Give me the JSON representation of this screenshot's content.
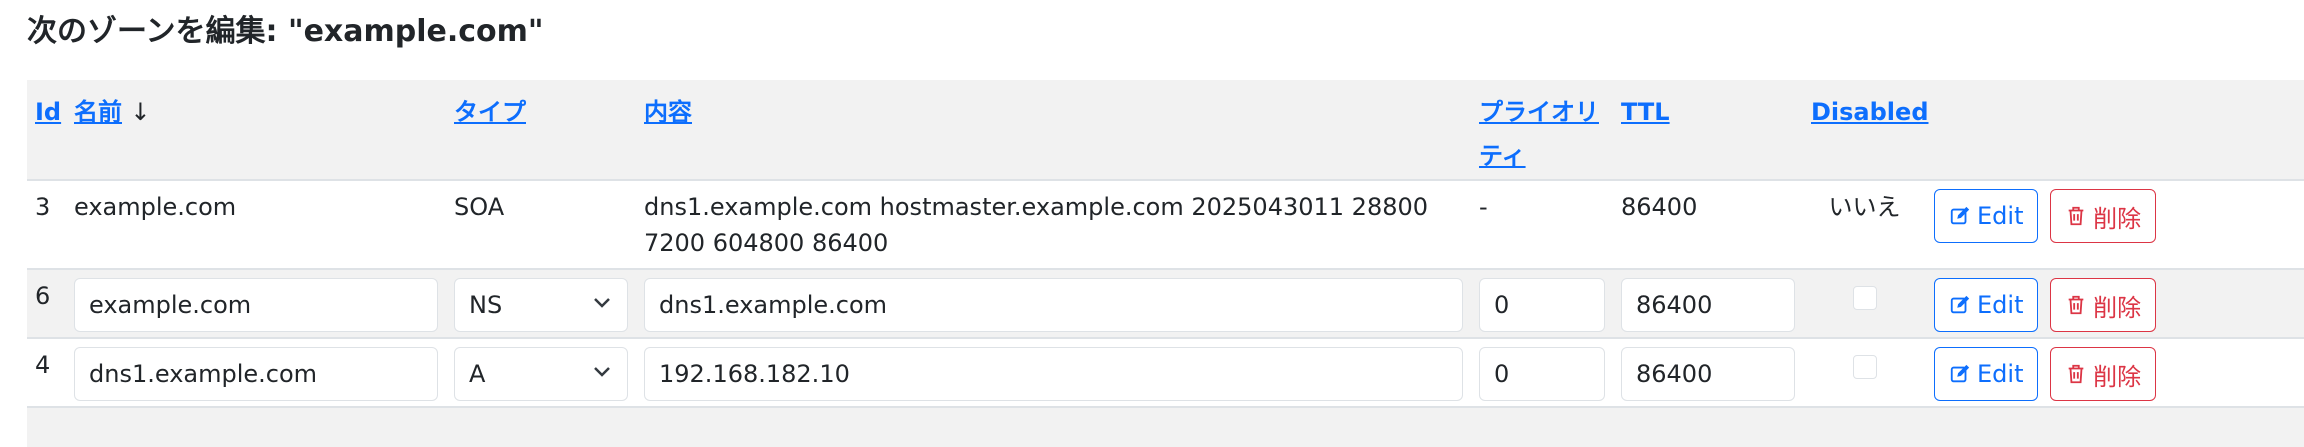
{
  "page_title": "次のゾーンを編集: \"example.com\"",
  "columns": {
    "id": "Id",
    "name": "名前",
    "name_sort": "↓",
    "type": "タイプ",
    "content": "内容",
    "priority": "プライオリティ",
    "ttl": "TTL",
    "disabled": "Disabled"
  },
  "rows": [
    {
      "id": "3",
      "name": "example.com",
      "type": "SOA",
      "content": "dns1.example.com hostmaster.example.com 2025043011 28800 7200 604800 86400",
      "priority": "-",
      "ttl": "86400",
      "disabled": "いいえ",
      "edit": "Edit",
      "delete": "削除"
    },
    {
      "id": "6",
      "name": "example.com",
      "type": "NS",
      "content": "dns1.example.com",
      "priority": "0",
      "ttl": "86400",
      "disabled": false,
      "edit": "Edit",
      "delete": "削除"
    },
    {
      "id": "4",
      "name": "dns1.example.com",
      "type": "A",
      "content": "192.168.182.10",
      "priority": "0",
      "ttl": "86400",
      "disabled": false,
      "edit": "Edit",
      "delete": "削除"
    }
  ],
  "colors": {
    "link": "#0d6efd",
    "danger": "#dc3545",
    "stripe": "#f2f2f2"
  }
}
